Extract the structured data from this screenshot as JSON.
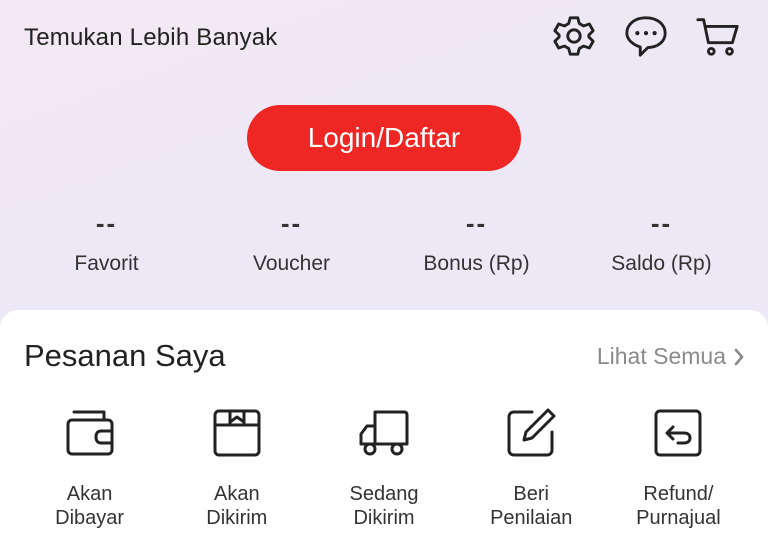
{
  "header": {
    "title": "Temukan Lebih Banyak",
    "icons": [
      "settings-gear-icon",
      "chat-bubble-icon",
      "shopping-cart-icon"
    ]
  },
  "login": {
    "label": "Login/Daftar",
    "color": "#ee2624"
  },
  "stats": [
    {
      "value": "--",
      "label": "Favorit"
    },
    {
      "value": "--",
      "label": "Voucher"
    },
    {
      "value": "--",
      "label": "Bonus (Rp)"
    },
    {
      "value": "--",
      "label": "Saldo (Rp)"
    }
  ],
  "orders": {
    "title": "Pesanan Saya",
    "see_all": "Lihat Semua",
    "items": [
      {
        "label": "Akan\nDibayar",
        "icon": "wallet-icon"
      },
      {
        "label": "Akan\nDikirim",
        "icon": "package-box-icon"
      },
      {
        "label": "Sedang\nDikirim",
        "icon": "delivery-truck-icon"
      },
      {
        "label": "Beri\nPenilaian",
        "icon": "edit-review-icon"
      },
      {
        "label": "Refund/\nPurnajual",
        "icon": "refund-return-icon"
      }
    ]
  }
}
